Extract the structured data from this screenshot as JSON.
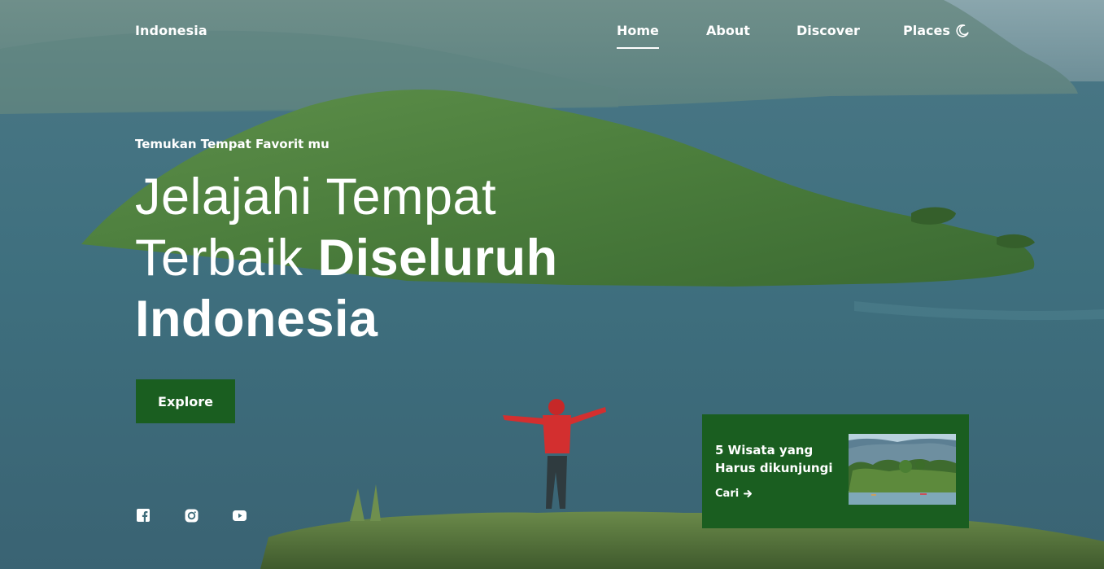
{
  "header": {
    "brand": "Indonesia",
    "nav": [
      {
        "label": "Home",
        "active": true
      },
      {
        "label": "About",
        "active": false
      },
      {
        "label": "Discover",
        "active": false
      },
      {
        "label": "Places",
        "active": false
      }
    ],
    "theme_icon": "moon-icon"
  },
  "hero": {
    "subtitle": "Temukan Tempat Favorit mu",
    "headline_light_1": "Jelajahi Tempat",
    "headline_light_2": "Terbaik ",
    "headline_bold_1": "Diseluruh",
    "headline_bold_2": "Indonesia",
    "explore_label": "Explore"
  },
  "social": [
    {
      "icon": "facebook-icon"
    },
    {
      "icon": "instagram-icon"
    },
    {
      "icon": "youtube-icon"
    }
  ],
  "card": {
    "title": "5 Wisata yang Harus dikunjungi",
    "link_label": "Cari",
    "link_icon": "arrow-right-icon"
  },
  "colors": {
    "accent": "#1a5e20",
    "text": "#ffffff"
  }
}
